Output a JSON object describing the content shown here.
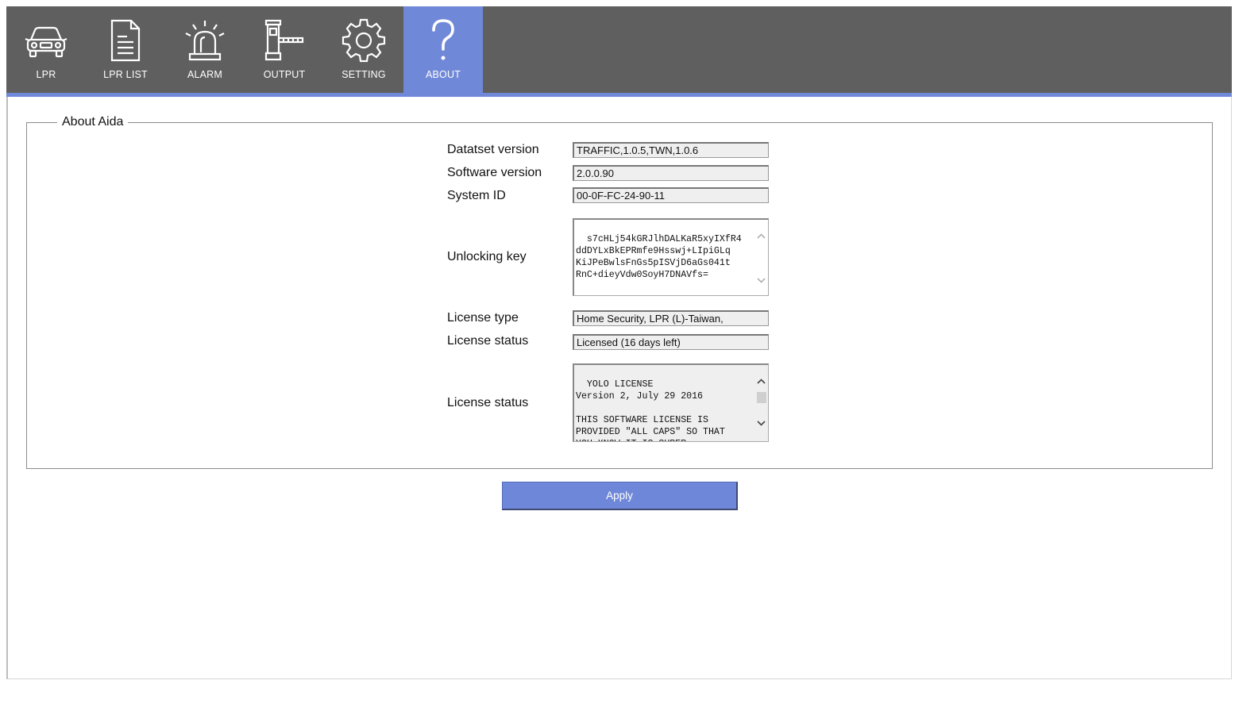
{
  "nav": {
    "items": [
      {
        "label": "LPR",
        "icon": "car-icon"
      },
      {
        "label": "LPR LIST",
        "icon": "document-icon"
      },
      {
        "label": "ALARM",
        "icon": "alarm-siren-icon"
      },
      {
        "label": "OUTPUT",
        "icon": "barrier-gate-icon"
      },
      {
        "label": "SETTING",
        "icon": "gear-icon"
      },
      {
        "label": "ABOUT",
        "icon": "question-icon"
      }
    ],
    "active_index": 5
  },
  "colors": {
    "nav_background": "#5f5f5f",
    "accent": "#7088d8",
    "button": "#6f87d8"
  },
  "panel": {
    "title": "About Aida",
    "dataset_version": {
      "label": "Datatset version",
      "value": "TRAFFIC,1.0.5,TWN,1.0.6"
    },
    "software_version": {
      "label": "Software version",
      "value": "2.0.0.90"
    },
    "system_id": {
      "label": "System ID",
      "value": "00-0F-FC-24-90-11"
    },
    "unlocking_key": {
      "label": "Unlocking key",
      "value": "s7cHLj54kGRJlhDALKaR5xyIXfR4\nddDYLxBkEPRmfe9Hsswj+LIpiGLq\nKiJPeBwlsFnGs5pISVjD6aGs041t\nRnC+dieyVdw0SoyH7DNAVfs="
    },
    "license_type": {
      "label": "License type",
      "value": "Home Security, LPR (L)-Taiwan,"
    },
    "license_status": {
      "label": "License status",
      "value": "Licensed (16 days left)"
    },
    "license_text": {
      "label": "License status",
      "value": "YOLO LICENSE\nVersion 2, July 29 2016\n\nTHIS SOFTWARE LICENSE IS\nPROVIDED \"ALL CAPS\" SO THAT\nYOU KNOW IT IS SUPER\nSERIOUS AND YOU DON'T MESS"
    }
  },
  "actions": {
    "apply_label": "Apply"
  }
}
